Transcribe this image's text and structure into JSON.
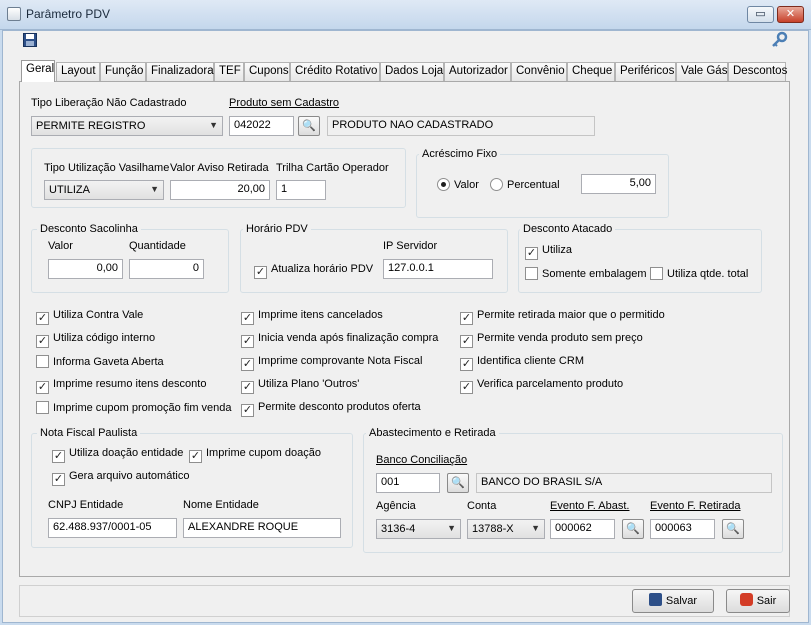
{
  "window": {
    "title": "Parâmetro PDV",
    "controls": {
      "restore": "▭",
      "close": "✕"
    },
    "icons": {
      "title": "form-icon",
      "save_toolbar": "floppy-disk-icon",
      "key": "key-icon"
    }
  },
  "tabs": [
    "Geral",
    "Layout",
    "Função",
    "Finalizadora",
    "TEF",
    "Cupons",
    "Crédito Rotativo",
    "Dados Loja",
    "Autorizador",
    "Convênio",
    "Cheque",
    "Periféricos",
    "Vale Gás",
    "Descontos"
  ],
  "active_tab": "Geral",
  "geral": {
    "tipo_liberacao": {
      "label": "Tipo Liberação Não Cadastrado",
      "value": "PERMITE REGISTRO"
    },
    "produto_sem_cadastro": {
      "label": "Produto sem Cadastro",
      "code": "042022",
      "description": "PRODUTO NAO CADASTRADO"
    },
    "tipo_utilizacao_vasilhame": {
      "label": "Tipo Utilização Vasilhame",
      "value": "UTILIZA"
    },
    "valor_aviso_retirada": {
      "label": "Valor Aviso Retirada",
      "value": "20,00"
    },
    "trilha_cartao_operador": {
      "label": "Trilha Cartão Operador",
      "value": "1"
    },
    "acrescimo_fixo": {
      "title": "Acréscimo Fixo",
      "option_valor": "Valor",
      "option_percentual": "Percentual",
      "selected": "Valor",
      "value": "5,00"
    },
    "desconto_sacolinha": {
      "title": "Desconto Sacolinha",
      "valor_label": "Valor",
      "valor": "0,00",
      "quantidade_label": "Quantidade",
      "quantidade": "0"
    },
    "horario_pdv": {
      "title": "Horário PDV",
      "atualiza_label": "Atualiza horário PDV",
      "atualiza_checked": true,
      "ip_label": "IP Servidor",
      "ip": "127.0.0.1"
    },
    "desconto_atacado": {
      "title": "Desconto Atacado",
      "utiliza": {
        "label": "Utiliza",
        "checked": true
      },
      "somente_embalagem": {
        "label": "Somente embalagem",
        "checked": false
      },
      "utiliza_qtde_total": {
        "label": "Utiliza qtde. total",
        "checked": false
      }
    },
    "options_col1": [
      {
        "label": "Utiliza Contra Vale",
        "checked": true
      },
      {
        "label": "Utiliza código interno",
        "checked": true
      },
      {
        "label": "Informa Gaveta Aberta",
        "checked": false
      },
      {
        "label": "Imprime resumo itens desconto",
        "checked": true
      },
      {
        "label": "Imprime cupom promoção fim venda",
        "checked": false
      }
    ],
    "options_col2": [
      {
        "label": "Imprime itens cancelados",
        "checked": true
      },
      {
        "label": "Inicia venda após finalização compra",
        "checked": true
      },
      {
        "label": "Imprime comprovante Nota Fiscal",
        "checked": true
      },
      {
        "label": "Utiliza Plano 'Outros'",
        "checked": true
      },
      {
        "label": "Permite desconto produtos oferta",
        "checked": true
      }
    ],
    "options_col3": [
      {
        "label": "Permite retirada maior que o permitido",
        "checked": true
      },
      {
        "label": "Permite venda produto sem preço",
        "checked": true
      },
      {
        "label": "Identifica cliente CRM",
        "checked": true
      },
      {
        "label": "Verifica parcelamento produto",
        "checked": true
      }
    ],
    "nota_fiscal_paulista": {
      "title": "Nota Fiscal Paulista",
      "utiliza_doacao": {
        "label": "Utiliza doação entidade",
        "checked": true
      },
      "imprime_cupom_doacao": {
        "label": "Imprime cupom doação",
        "checked": true
      },
      "gera_arquivo": {
        "label": "Gera arquivo automático",
        "checked": true
      },
      "cnpj_label": "CNPJ Entidade",
      "cnpj": "62.488.937/0001-05",
      "nome_label": "Nome Entidade",
      "nome": "ALEXANDRE ROQUE"
    },
    "abastecimento": {
      "title": "Abastecimento e Retirada",
      "banco_label": "Banco Conciliação",
      "banco_code": "001",
      "banco_name": "BANCO DO BRASIL S/A",
      "agencia_label": "Agência",
      "agencia": "3136-4",
      "conta_label": "Conta",
      "conta": "13788-X",
      "evento_abast_label": "Evento  F. Abast.",
      "evento_abast": "000062",
      "evento_retirada_label": "Evento F. Retirada",
      "evento_retirada": "000063"
    }
  },
  "footer": {
    "save": "Salvar",
    "exit": "Sair"
  },
  "colors": {
    "accent": "#1d5da8",
    "window_frame": "#c9dbee",
    "panel": "#f0f0f0"
  }
}
